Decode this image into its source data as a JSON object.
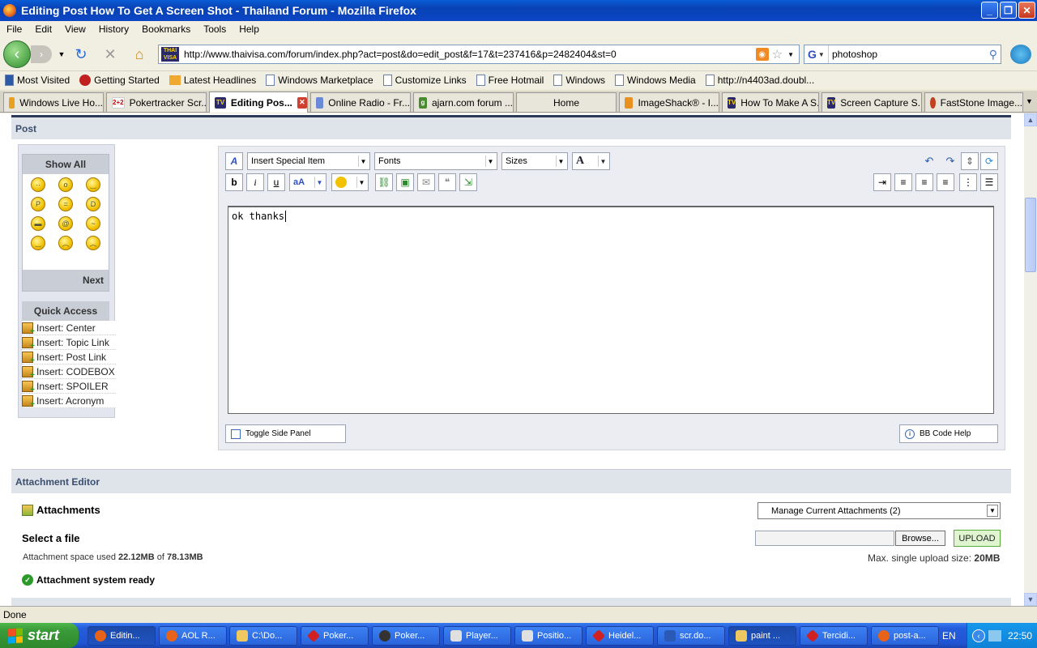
{
  "window": {
    "title": "Editing Post How To Get A Screen Shot - Thailand Forum - Mozilla Firefox"
  },
  "menu": [
    "File",
    "Edit",
    "View",
    "History",
    "Bookmarks",
    "Tools",
    "Help"
  ],
  "nav": {
    "url": "http://www.thaivisa.com/forum/index.php?act=post&do=edit_post&f=17&t=237416&p=2482404&st=0",
    "search_value": "photoshop"
  },
  "bookmarks": [
    "Most Visited",
    "Getting Started",
    "Latest Headlines",
    "Windows Marketplace",
    "Customize Links",
    "Free Hotmail",
    "Windows",
    "Windows Media",
    "http://n4403ad.doubl..."
  ],
  "tabs": [
    "Windows Live Ho...",
    "Pokertracker Scr...",
    "Editing Pos...",
    "Online Radio - Fr...",
    "ajarn.com forum ...",
    "Home",
    "ImageShack® - I...",
    "How To Make A S...",
    "Screen Capture S...",
    "FastStone Image..."
  ],
  "post": {
    "section_title": "Post",
    "show_all": "Show All",
    "next": "Next",
    "quick_access": "Quick Access",
    "quick_items": [
      "Insert: Center",
      "Insert: Topic Link",
      "Insert: Post Link",
      "Insert: CODEBOX",
      "Insert: SPOILER",
      "Insert: Acronym"
    ],
    "special_item": "Insert Special Item",
    "fonts": "Fonts",
    "sizes": "Sizes",
    "bold": "b",
    "italic": "i",
    "underline": "u",
    "editor_text": "ok thanks",
    "toggle_panel": "Toggle Side Panel",
    "bbcode_help": "BB Code Help"
  },
  "attachments": {
    "section_title": "Attachment Editor",
    "label": "Attachments",
    "manage": "Manage Current Attachments (2)",
    "select_file": "Select a file",
    "browse": "Browse...",
    "upload": "UPLOAD",
    "space_prefix": "Attachment space used",
    "space_used": "22.12MB",
    "space_of": "of",
    "space_total": "78.13MB",
    "max_prefix": "Max. single upload size:",
    "max_size": "20MB",
    "ready": "Attachment system ready"
  },
  "status": "Done",
  "taskbar": {
    "start": "start",
    "items": [
      "Editin...",
      "AOL R...",
      "C:\\Do...",
      "Poker...",
      "Poker...",
      "Player...",
      "Positio...",
      "Heidel...",
      "scr.do...",
      "paint ...",
      "Tercidi...",
      "post-a..."
    ],
    "lang": "EN",
    "clock": "22:50"
  }
}
